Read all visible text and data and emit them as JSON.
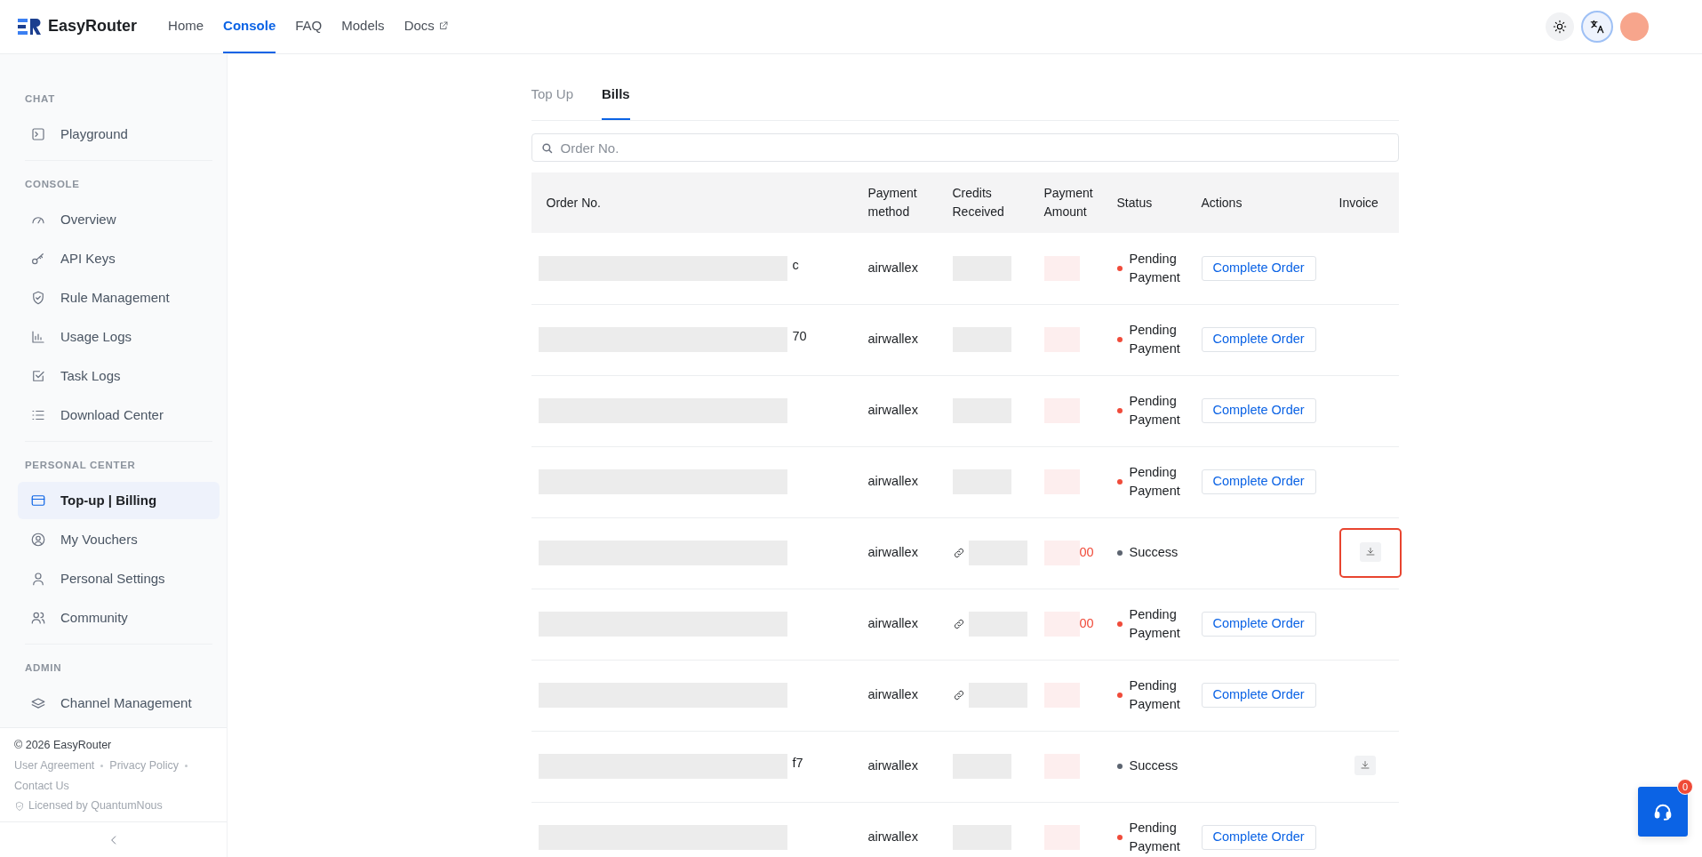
{
  "brand": "EasyRouter",
  "nav": [
    {
      "label": "Home",
      "selected": false
    },
    {
      "label": "Console",
      "selected": true
    },
    {
      "label": "FAQ",
      "selected": false
    },
    {
      "label": "Models",
      "selected": false
    },
    {
      "label": "Docs",
      "selected": false,
      "external": true
    }
  ],
  "sidebar": {
    "sections": [
      {
        "title": "CHAT",
        "items": [
          {
            "label": "Playground",
            "kind": "terminal",
            "selected": false
          }
        ]
      },
      {
        "title": "CONSOLE",
        "items": [
          {
            "label": "Overview",
            "kind": "gauge",
            "selected": false
          },
          {
            "label": "API Keys",
            "kind": "key",
            "selected": false
          },
          {
            "label": "Rule Management",
            "kind": "shield",
            "selected": false
          },
          {
            "label": "Usage Logs",
            "kind": "chart",
            "selected": false
          },
          {
            "label": "Task Logs",
            "kind": "check",
            "selected": false
          },
          {
            "label": "Download Center",
            "kind": "list",
            "selected": false
          }
        ]
      },
      {
        "title": "PERSONAL CENTER",
        "items": [
          {
            "label": "Top-up | Billing",
            "kind": "card",
            "selected": true
          },
          {
            "label": "My Vouchers",
            "kind": "usercircle",
            "selected": false
          },
          {
            "label": "Personal Settings",
            "kind": "user",
            "selected": false
          },
          {
            "label": "Community",
            "kind": "users",
            "selected": false
          }
        ]
      },
      {
        "title": "ADMIN",
        "items": [
          {
            "label": "Channel Management",
            "kind": "layers",
            "selected": false
          }
        ]
      }
    ]
  },
  "footer": {
    "copyright": "© 2026 EasyRouter",
    "links": [
      "User Agreement",
      "Privacy Policy",
      "Contact Us"
    ],
    "license": "Licensed by QuantumNous"
  },
  "tabs": [
    {
      "label": "Top Up",
      "selected": false
    },
    {
      "label": "Bills",
      "selected": true
    }
  ],
  "search": {
    "placeholder": "Order No."
  },
  "table": {
    "columns": [
      "Order No.",
      "Payment method",
      "Credits Received",
      "Payment Amount",
      "Status",
      "Actions",
      "Invoice"
    ],
    "rows": [
      {
        "order_tail": "c",
        "payment_method": "airwallex",
        "status": "Pending Payment",
        "kind": "pending",
        "action": "Complete Order"
      },
      {
        "order_tail": "70",
        "payment_method": "airwallex",
        "status": "Pending Payment",
        "kind": "pending",
        "action": "Complete Order"
      },
      {
        "payment_method": "airwallex",
        "status": "Pending Payment",
        "kind": "pending",
        "action": "Complete Order"
      },
      {
        "payment_method": "airwallex",
        "status": "Pending Payment",
        "kind": "pending",
        "action": "Complete Order"
      },
      {
        "payment_method": "airwallex",
        "credit_link": true,
        "amount_tail": "00",
        "status": "Success",
        "kind": "success",
        "invoice": true,
        "highlighted": true
      },
      {
        "payment_method": "airwallex",
        "credit_link": true,
        "amount_tail": "00",
        "status": "Pending Payment",
        "kind": "pending",
        "action": "Complete Order"
      },
      {
        "payment_method": "airwallex",
        "credit_link": true,
        "status": "Pending Payment",
        "kind": "pending",
        "action": "Complete Order"
      },
      {
        "order_tail": "f7",
        "payment_method": "airwallex",
        "status": "Success",
        "kind": "success",
        "invoice": true
      },
      {
        "payment_method": "airwallex",
        "status": "Pending Payment",
        "kind": "pending",
        "action": "Complete Order"
      }
    ]
  },
  "support": {
    "badge": "0"
  }
}
